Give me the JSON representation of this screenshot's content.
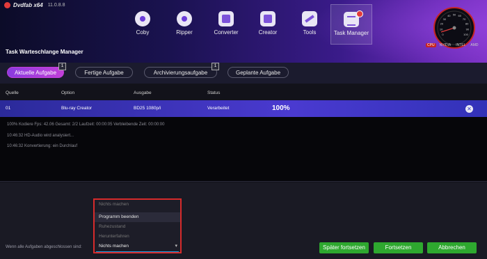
{
  "app": {
    "name": "Dvdfab x64",
    "version": "11.0.8.8"
  },
  "nav": [
    {
      "label": "Coby",
      "icon": "disc-icon"
    },
    {
      "label": "Ripper",
      "icon": "disc-icon"
    },
    {
      "label": "Converter",
      "icon": "film-icon"
    },
    {
      "label": "Creator",
      "icon": "film-icon"
    },
    {
      "label": "Tools",
      "icon": "tools-icon"
    },
    {
      "label": "Task Manager",
      "icon": "task-icon",
      "active": true
    }
  ],
  "gauge": {
    "scale": [
      "0",
      "10",
      "20",
      "30",
      "40",
      "50",
      "60",
      "70",
      "80",
      "90",
      "100"
    ],
    "legend": [
      "CPU",
      "NVIDIA",
      "INTEL",
      "AMD"
    ]
  },
  "page_title": "Task Warteschlange Manager",
  "tabs": [
    {
      "label": "Aktuelle Aufgabe",
      "badge": "1",
      "active": true
    },
    {
      "label": "Fertige Aufgabe"
    },
    {
      "label": "Archivierungsaufgabe",
      "badge": "1"
    },
    {
      "label": "Geplante Aufgabe"
    }
  ],
  "table": {
    "headers": [
      "Quelle",
      "Option",
      "Ausgabe",
      "Status"
    ],
    "row": {
      "source": "01",
      "option": "Blu-ray Creator",
      "output": "BD25 1080p/i",
      "status": "Verarbeitet",
      "progress": "100%"
    }
  },
  "log": [
    "100%  Kodiere Fps: 42.06   Gesamt: 2/2   Laufzeit: 00:00:05   Verbleibende Zeit: 00:00:00",
    "10:46:32    HD-Audio wird analysiert...",
    "10:46:32    Konvertierung: ein Durchlauf"
  ],
  "footer": {
    "when_done_label": "Wenn alle Aufgaben abgeschlossen sind:",
    "options": [
      "Nichts machen",
      "Programm beenden",
      "Ruhezustand",
      "Herunterfahren"
    ],
    "selected": "Nichts machen",
    "buttons": {
      "resume_later": "Später fortsetzen",
      "resume": "Fortsetzen",
      "cancel": "Abbrechen"
    }
  },
  "colors": {
    "accent": "#8a3be0",
    "selected_row": "#3a36c0",
    "button_green": "#2ea82f",
    "highlight_red": "#d72b2b"
  }
}
